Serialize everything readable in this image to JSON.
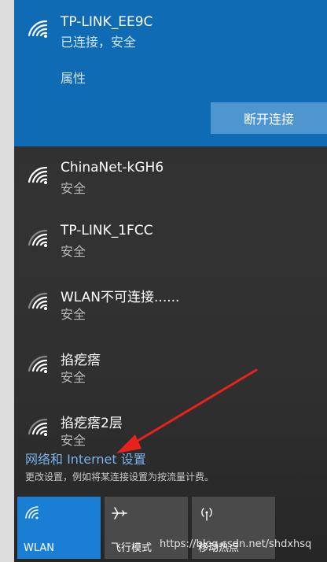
{
  "connected": {
    "ssid": "TP-LINK_EE9C",
    "status": "已连接，安全",
    "properties": "属性",
    "disconnect": "断开连接"
  },
  "networks": [
    {
      "ssid": "ChinaNet-kGH6",
      "security": "安全"
    },
    {
      "ssid": "TP-LINK_1FCC",
      "security": "安全"
    },
    {
      "ssid": "WLAN不可连接......",
      "security": "安全"
    },
    {
      "ssid": "掐疙瘩",
      "security": "安全"
    },
    {
      "ssid": "掐疙瘩2层",
      "security": "安全"
    }
  ],
  "settings": {
    "link": "网络和 Internet 设置",
    "description": "更改设置，例如将某连接设置为按流量计费。"
  },
  "tiles": [
    {
      "label": "WLAN",
      "icon": "wifi-icon",
      "active": true
    },
    {
      "label": "飞行模式",
      "icon": "airplane-icon",
      "active": false
    },
    {
      "label": "移动热点",
      "icon": "hotspot-icon",
      "active": false
    }
  ],
  "watermark": "https://blog.csdn.net/shdxhsq",
  "colors": {
    "accent": "#0f6bb3",
    "annotation_arrow": "#e8211b"
  }
}
